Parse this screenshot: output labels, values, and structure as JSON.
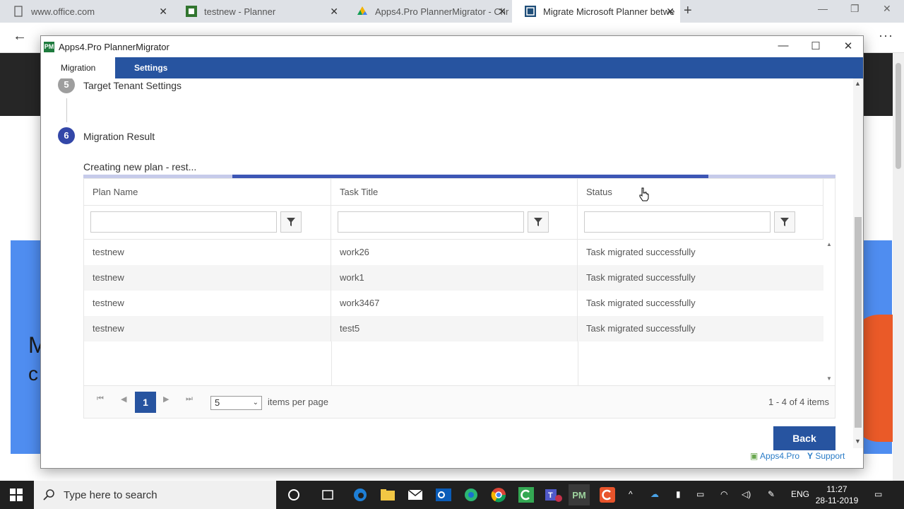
{
  "browser": {
    "tabs": [
      {
        "title": "www.office.com",
        "icon": "document-icon"
      },
      {
        "title": "testnew - Planner",
        "icon": "planner-icon"
      },
      {
        "title": "Apps4.Pro PlannerMigrator - Chr",
        "icon": "drive-icon"
      },
      {
        "title": "Migrate Microsoft Planner betwe",
        "icon": "app-icon"
      }
    ]
  },
  "window": {
    "icon_text": "PM",
    "title": "Apps4.Pro PlannerMigrator"
  },
  "nav": {
    "tabs": [
      "Migration",
      "Settings"
    ]
  },
  "steps": [
    {
      "number": "5",
      "label": "Target Tenant Settings",
      "color": "#9e9e9e"
    },
    {
      "number": "6",
      "label": "Migration Result",
      "color": "#3347a8"
    }
  ],
  "progress": {
    "status": "Creating new plan - rest...",
    "fill_start": 0.198,
    "fill_end": 0.831
  },
  "grid": {
    "columns": [
      "Plan Name",
      "Task Title",
      "Status"
    ],
    "rows": [
      [
        "testnew",
        "work26",
        "Task migrated successfully"
      ],
      [
        "testnew",
        "work1",
        "Task migrated successfully"
      ],
      [
        "testnew",
        "work3467",
        "Task migrated successfully"
      ],
      [
        "testnew",
        "test5",
        "Task migrated successfully"
      ]
    ]
  },
  "pager": {
    "current_page": "1",
    "page_size": "5",
    "items_per_page_label": "items per page",
    "info": "1 - 4 of 4 items"
  },
  "actions": {
    "back_label": "Back"
  },
  "footer": {
    "apps4pro": "Apps4.Pro",
    "support": "Support"
  },
  "taskbar": {
    "search_placeholder": "Type here to search",
    "language": "ENG",
    "time": "11:27",
    "date": "28-11-2019"
  },
  "colors": {
    "accent": "#2754a0",
    "progress_fill": "#3d56b5",
    "progress_track": "#c6cbea"
  }
}
